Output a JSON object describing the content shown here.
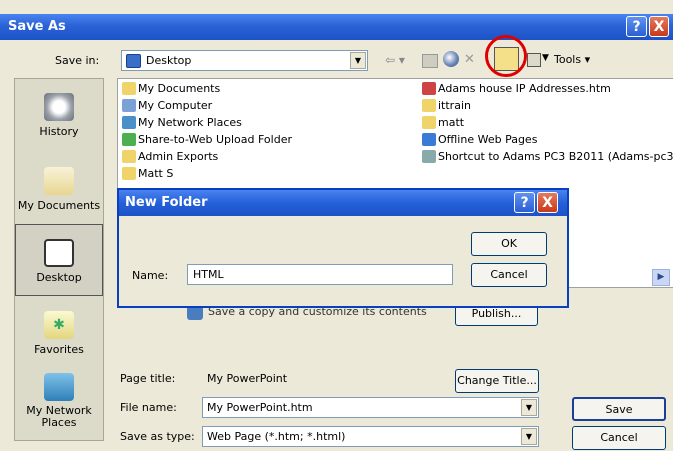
{
  "window": {
    "title": "Save As",
    "help": "?",
    "close": "X"
  },
  "save_in": {
    "label": "Save in:",
    "value": "Desktop"
  },
  "toolbar": {
    "tools_label": "Tools"
  },
  "places": [
    {
      "label": "History"
    },
    {
      "label": "My Documents"
    },
    {
      "label": "Desktop"
    },
    {
      "label": "Favorites"
    },
    {
      "label": "My Network Places"
    }
  ],
  "files_left": [
    "My Documents",
    "My Computer",
    "My Network Places",
    "Share-to-Web Upload Folder",
    "Admin Exports",
    "Matt S"
  ],
  "files_right": [
    "Adams house IP Addresses.htm",
    "ittrain",
    "matt",
    "Offline Web Pages",
    "Shortcut to Adams PC3 B2011 (Adams-pc3"
  ],
  "save_copy_text": "Save a copy and customize its contents",
  "publish_label": "Publish...",
  "page_title": {
    "label": "Page title:",
    "value": "My PowerPoint",
    "change_button": "Change Title..."
  },
  "file_name": {
    "label": "File name:",
    "value": "My PowerPoint.htm"
  },
  "save_type": {
    "label": "Save as type:",
    "value": "Web Page (*.htm; *.html)"
  },
  "save_button": "Save",
  "cancel_button": "Cancel",
  "new_folder": {
    "title": "New Folder",
    "help": "?",
    "close": "X",
    "name_label": "Name:",
    "name_value": "HTML",
    "ok": "OK",
    "cancel": "Cancel"
  }
}
